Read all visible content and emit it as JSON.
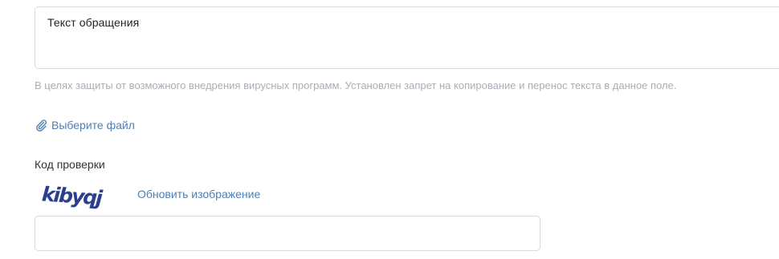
{
  "form": {
    "message_placeholder": "Текст обращения",
    "message_value": "",
    "copy_protection_hint": "В целях защиты от возможного внедрения вирусных программ. Установлен запрет на копирование и перенос текста в данное поле.",
    "attach_file_label": "Выберите файл",
    "attach_icon": "paperclip-icon",
    "captcha": {
      "label": "Код проверки",
      "image_text": "kibyqj",
      "refresh_label": "Обновить изображение",
      "input_value": "",
      "input_placeholder": ""
    }
  },
  "colors": {
    "link": "#4d7fb3",
    "hint": "#a9aeb5",
    "border": "#d6d9de",
    "captcha_text": "#2a3f8f"
  }
}
